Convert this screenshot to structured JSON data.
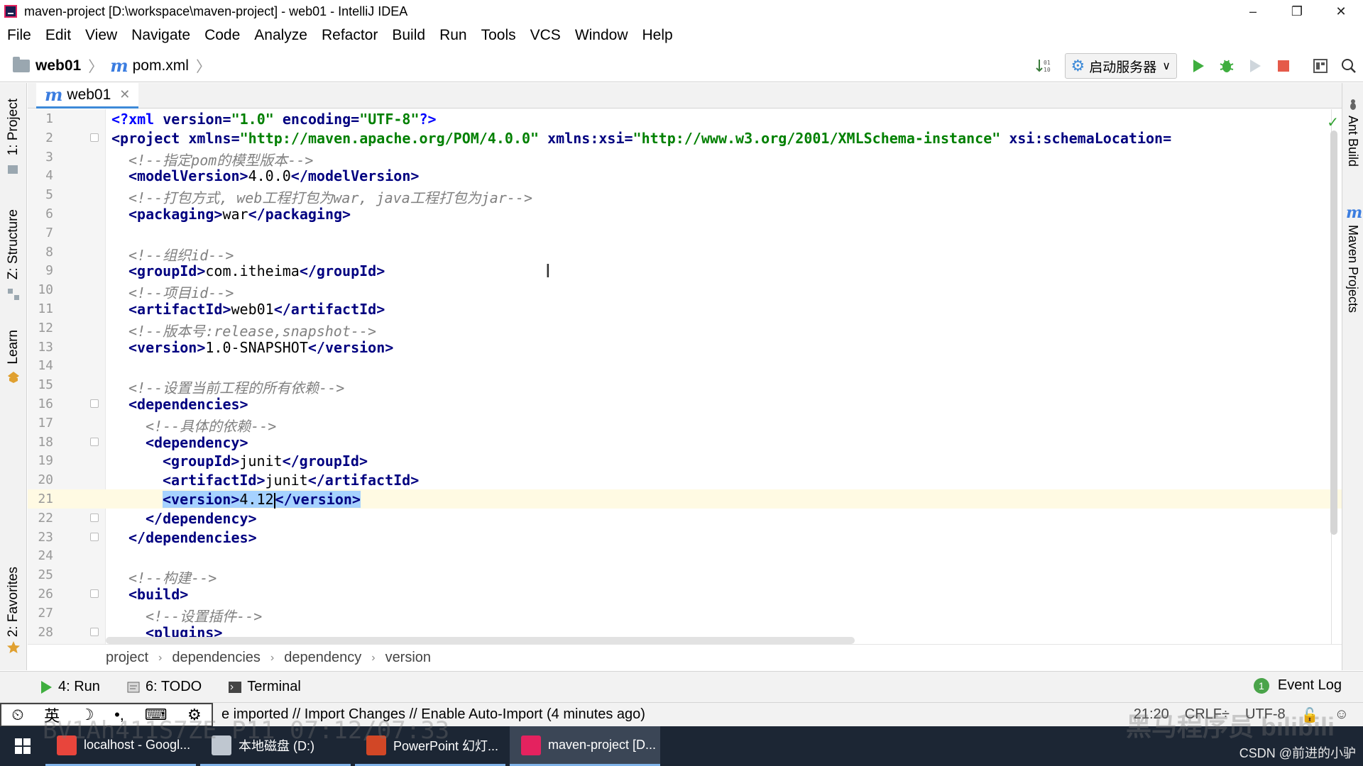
{
  "window": {
    "title": "maven-project [D:\\workspace\\maven-project] - web01 - IntelliJ IDEA",
    "controls": [
      "–",
      "❐",
      "✕"
    ]
  },
  "menu": [
    "File",
    "Edit",
    "View",
    "Navigate",
    "Code",
    "Analyze",
    "Refactor",
    "Build",
    "Run",
    "Tools",
    "VCS",
    "Window",
    "Help"
  ],
  "nav": {
    "project": "web01",
    "file": "pom.xml",
    "run_config": "启动服务器"
  },
  "left_tabs": {
    "project": "1: Project",
    "structure": "Z: Structure",
    "learn": "Learn",
    "favorites": "2: Favorites"
  },
  "right_tabs": {
    "ant": "Ant Build",
    "maven": "Maven Projects"
  },
  "editor_tab": "web01",
  "code_lines": [
    {
      "n": "1",
      "i": 0,
      "parts": [
        [
          "a",
          "<?xml "
        ],
        [
          "t",
          "version="
        ],
        [
          "s",
          "\"1.0\" "
        ],
        [
          "t",
          "encoding="
        ],
        [
          "s",
          "\"UTF-8\""
        ],
        [
          "a",
          "?>"
        ]
      ]
    },
    {
      "n": "2",
      "i": 0,
      "fold": true,
      "parts": [
        [
          "t",
          "<project "
        ],
        [
          "t",
          "xmlns="
        ],
        [
          "s",
          "\"http://maven.apache.org/POM/4.0.0\" "
        ],
        [
          "t",
          "xmlns:xsi="
        ],
        [
          "s",
          "\"http://www.w3.org/2001/XMLSchema-instance\" "
        ],
        [
          "t",
          "xsi:schemaLocation="
        ]
      ]
    },
    {
      "n": "3",
      "i": 1,
      "parts": [
        [
          "c",
          "<!--指定pom的模型版本-->"
        ]
      ]
    },
    {
      "n": "4",
      "i": 1,
      "parts": [
        [
          "t",
          "<modelVersion>"
        ],
        [
          "v",
          "4.0.0"
        ],
        [
          "t",
          "</modelVersion>"
        ]
      ]
    },
    {
      "n": "5",
      "i": 1,
      "parts": [
        [
          "c",
          "<!--打包方式, web工程打包为war, java工程打包为jar-->"
        ]
      ]
    },
    {
      "n": "6",
      "i": 1,
      "parts": [
        [
          "t",
          "<packaging>"
        ],
        [
          "v",
          "war"
        ],
        [
          "t",
          "</packaging>"
        ]
      ]
    },
    {
      "n": "7",
      "i": 0,
      "parts": []
    },
    {
      "n": "8",
      "i": 1,
      "parts": [
        [
          "c",
          "<!--组织id-->"
        ]
      ]
    },
    {
      "n": "9",
      "i": 1,
      "parts": [
        [
          "t",
          "<groupId>"
        ],
        [
          "v",
          "com.itheima"
        ],
        [
          "t",
          "</groupId>"
        ]
      ]
    },
    {
      "n": "10",
      "i": 1,
      "parts": [
        [
          "c",
          "<!--项目id-->"
        ]
      ]
    },
    {
      "n": "11",
      "i": 1,
      "parts": [
        [
          "t",
          "<artifactId>"
        ],
        [
          "v",
          "web01"
        ],
        [
          "t",
          "</artifactId>"
        ]
      ]
    },
    {
      "n": "12",
      "i": 1,
      "parts": [
        [
          "c",
          "<!--版本号:release,snapshot-->"
        ]
      ]
    },
    {
      "n": "13",
      "i": 1,
      "parts": [
        [
          "t",
          "<version>"
        ],
        [
          "v",
          "1.0-SNAPSHOT"
        ],
        [
          "t",
          "</version>"
        ]
      ]
    },
    {
      "n": "14",
      "i": 0,
      "parts": []
    },
    {
      "n": "15",
      "i": 1,
      "parts": [
        [
          "c",
          "<!--设置当前工程的所有依赖-->"
        ]
      ]
    },
    {
      "n": "16",
      "i": 1,
      "fold": true,
      "parts": [
        [
          "t",
          "<dependencies>"
        ]
      ]
    },
    {
      "n": "17",
      "i": 2,
      "parts": [
        [
          "c",
          "<!--具体的依赖-->"
        ]
      ]
    },
    {
      "n": "18",
      "i": 2,
      "fold": true,
      "parts": [
        [
          "t",
          "<dependency>"
        ]
      ]
    },
    {
      "n": "19",
      "i": 3,
      "parts": [
        [
          "t",
          "<groupId>"
        ],
        [
          "v",
          "junit"
        ],
        [
          "t",
          "</groupId>"
        ]
      ]
    },
    {
      "n": "20",
      "i": 3,
      "parts": [
        [
          "t",
          "<artifactId>"
        ],
        [
          "v",
          "junit"
        ],
        [
          "t",
          "</artifactId>"
        ]
      ]
    },
    {
      "n": "21",
      "i": 3,
      "current": true,
      "parts": [
        [
          "t",
          "<version>"
        ],
        [
          "v",
          "4.12"
        ],
        [
          "caret",
          ""
        ],
        [
          "t",
          "</version>"
        ]
      ]
    },
    {
      "n": "22",
      "i": 2,
      "fold": true,
      "parts": [
        [
          "t",
          "</dependency>"
        ]
      ]
    },
    {
      "n": "23",
      "i": 1,
      "fold": true,
      "parts": [
        [
          "t",
          "</dependencies>"
        ]
      ]
    },
    {
      "n": "24",
      "i": 0,
      "parts": []
    },
    {
      "n": "25",
      "i": 1,
      "parts": [
        [
          "c",
          "<!--构建-->"
        ]
      ]
    },
    {
      "n": "26",
      "i": 1,
      "fold": true,
      "parts": [
        [
          "t",
          "<build>"
        ]
      ]
    },
    {
      "n": "27",
      "i": 2,
      "parts": [
        [
          "c",
          "<!--设置插件-->"
        ]
      ]
    },
    {
      "n": "28",
      "i": 2,
      "fold": true,
      "parts": [
        [
          "t",
          "<plugins>"
        ]
      ]
    }
  ],
  "breadcrumb": [
    "project",
    "dependencies",
    "dependency",
    "version"
  ],
  "bottom_tools": {
    "run": "4: Run",
    "todo": "6: TODO",
    "terminal": "Terminal",
    "event_log": "Event Log",
    "event_count": "1"
  },
  "status": {
    "message": "e imported // Import Changes // Enable Auto-Import (4 minutes ago)",
    "position": "21:20",
    "line_sep": "CRLF÷",
    "encoding": "UTF-8",
    "ime": [
      "⏲",
      "英",
      "☽",
      "•,",
      "⌨",
      "⚙"
    ]
  },
  "watermarks": {
    "video_id": "BV1Ah411S7ZE P11 07:12/07:33",
    "brand": "黑马程序员 bilibili",
    "csdn": "CSDN @前进的小驴"
  },
  "taskbar": [
    {
      "label": "localhost - Googl...",
      "color": "#e8453c"
    },
    {
      "label": "本地磁盘 (D:)",
      "color": "#bfc7d0"
    },
    {
      "label": "PowerPoint 幻灯...",
      "color": "#d24726"
    },
    {
      "label": "maven-project [D...",
      "color": "#e4225f",
      "active": true
    }
  ]
}
